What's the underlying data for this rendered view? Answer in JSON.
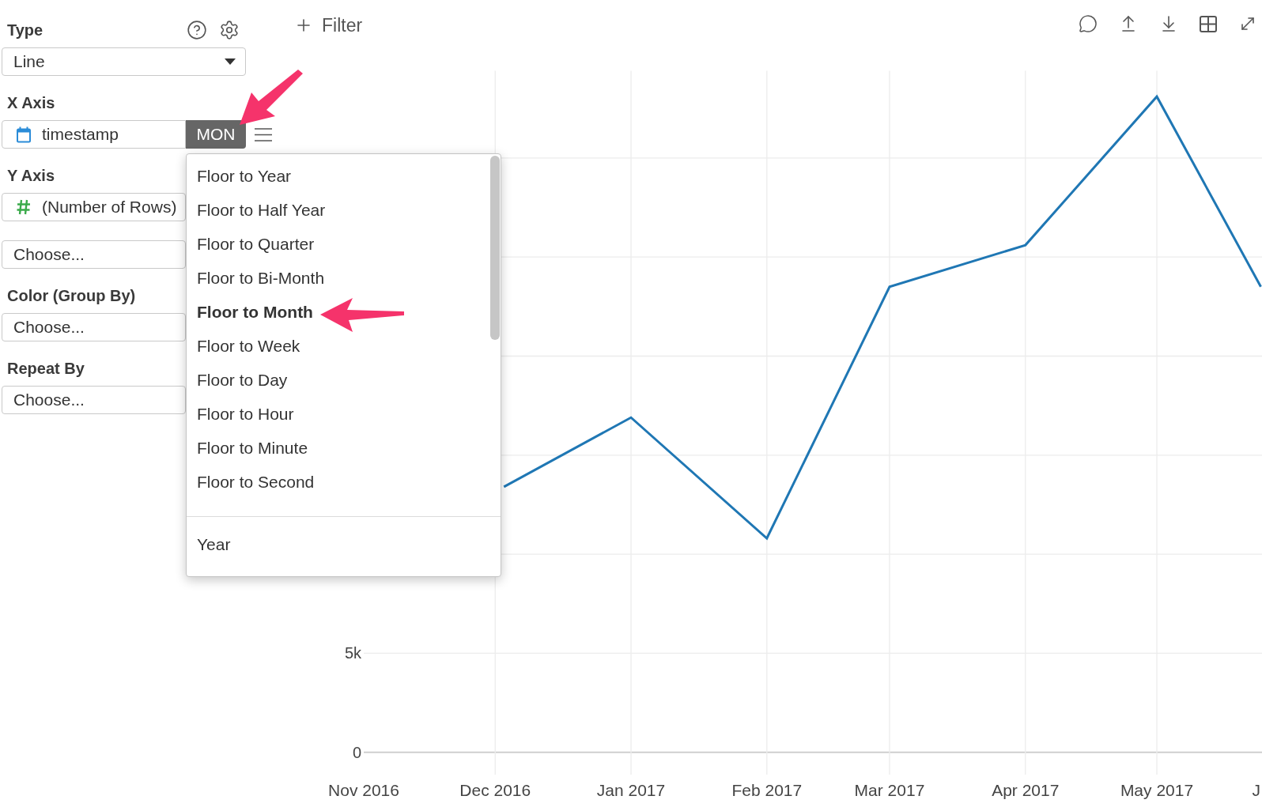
{
  "chart_type": {
    "label": "Type",
    "value": "Line"
  },
  "sections": [
    {
      "label": "X Axis",
      "fields": [
        {
          "kind": "date",
          "value": "timestamp",
          "aggregation": "MON"
        }
      ]
    },
    {
      "label": "Y Axis",
      "fields": [
        {
          "kind": "number",
          "value": "(Number of Rows)"
        },
        {
          "kind": "empty",
          "placeholder": "Choose..."
        }
      ]
    },
    {
      "label": "Color (Group By)",
      "fields": [
        {
          "kind": "empty",
          "placeholder": "Choose..."
        }
      ]
    },
    {
      "label": "Repeat By",
      "fields": [
        {
          "kind": "empty",
          "placeholder": "Choose..."
        }
      ]
    }
  ],
  "filter": {
    "label": "Filter"
  },
  "time_menu": {
    "open": true,
    "groups": [
      {
        "items": [
          {
            "label": "Floor to Year",
            "selected": false
          },
          {
            "label": "Floor to Half Year",
            "selected": false
          },
          {
            "label": "Floor to Quarter",
            "selected": false
          },
          {
            "label": "Floor to Bi-Month",
            "selected": false
          },
          {
            "label": "Floor to Month",
            "selected": true
          },
          {
            "label": "Floor to Week",
            "selected": false
          },
          {
            "label": "Floor to Day",
            "selected": false
          },
          {
            "label": "Floor to Hour",
            "selected": false
          },
          {
            "label": "Floor to Minute",
            "selected": false
          },
          {
            "label": "Floor to Second",
            "selected": false
          }
        ]
      },
      {
        "items": [
          {
            "label": "Year",
            "selected": false
          }
        ]
      }
    ]
  },
  "chart": {
    "chart_data": {
      "type": "line",
      "grid": true,
      "x": [
        "2016-12-03",
        "2017-01-01",
        "2017-02-01",
        "2017-03-01",
        "2017-04-01",
        "2017-05-01",
        "2017-05-25"
      ],
      "series": [
        {
          "color": "#1f77b4",
          "values": [
            13400,
            16900,
            10800,
            23500,
            25600,
            33100,
            23500
          ]
        }
      ],
      "xlim": [
        "2016-11-01",
        "2017-05-25"
      ],
      "ylim": [
        0,
        34400
      ],
      "xticks": [
        {
          "value": "2016-11-01",
          "label": "Nov 2016"
        },
        {
          "value": "2016-12-01",
          "label": "Dec 2016"
        },
        {
          "value": "2017-01-01",
          "label": "Jan 2017"
        },
        {
          "value": "2017-02-01",
          "label": "Feb 2017"
        },
        {
          "value": "2017-03-01",
          "label": "Mar 2017"
        },
        {
          "value": "2017-04-01",
          "label": "Apr 2017"
        },
        {
          "value": "2017-05-01",
          "label": "May 2017"
        }
      ],
      "yticks": [
        {
          "value": 0,
          "label": "0"
        },
        {
          "value": 5000,
          "label": "5k"
        }
      ]
    },
    "edge_label": "J"
  }
}
